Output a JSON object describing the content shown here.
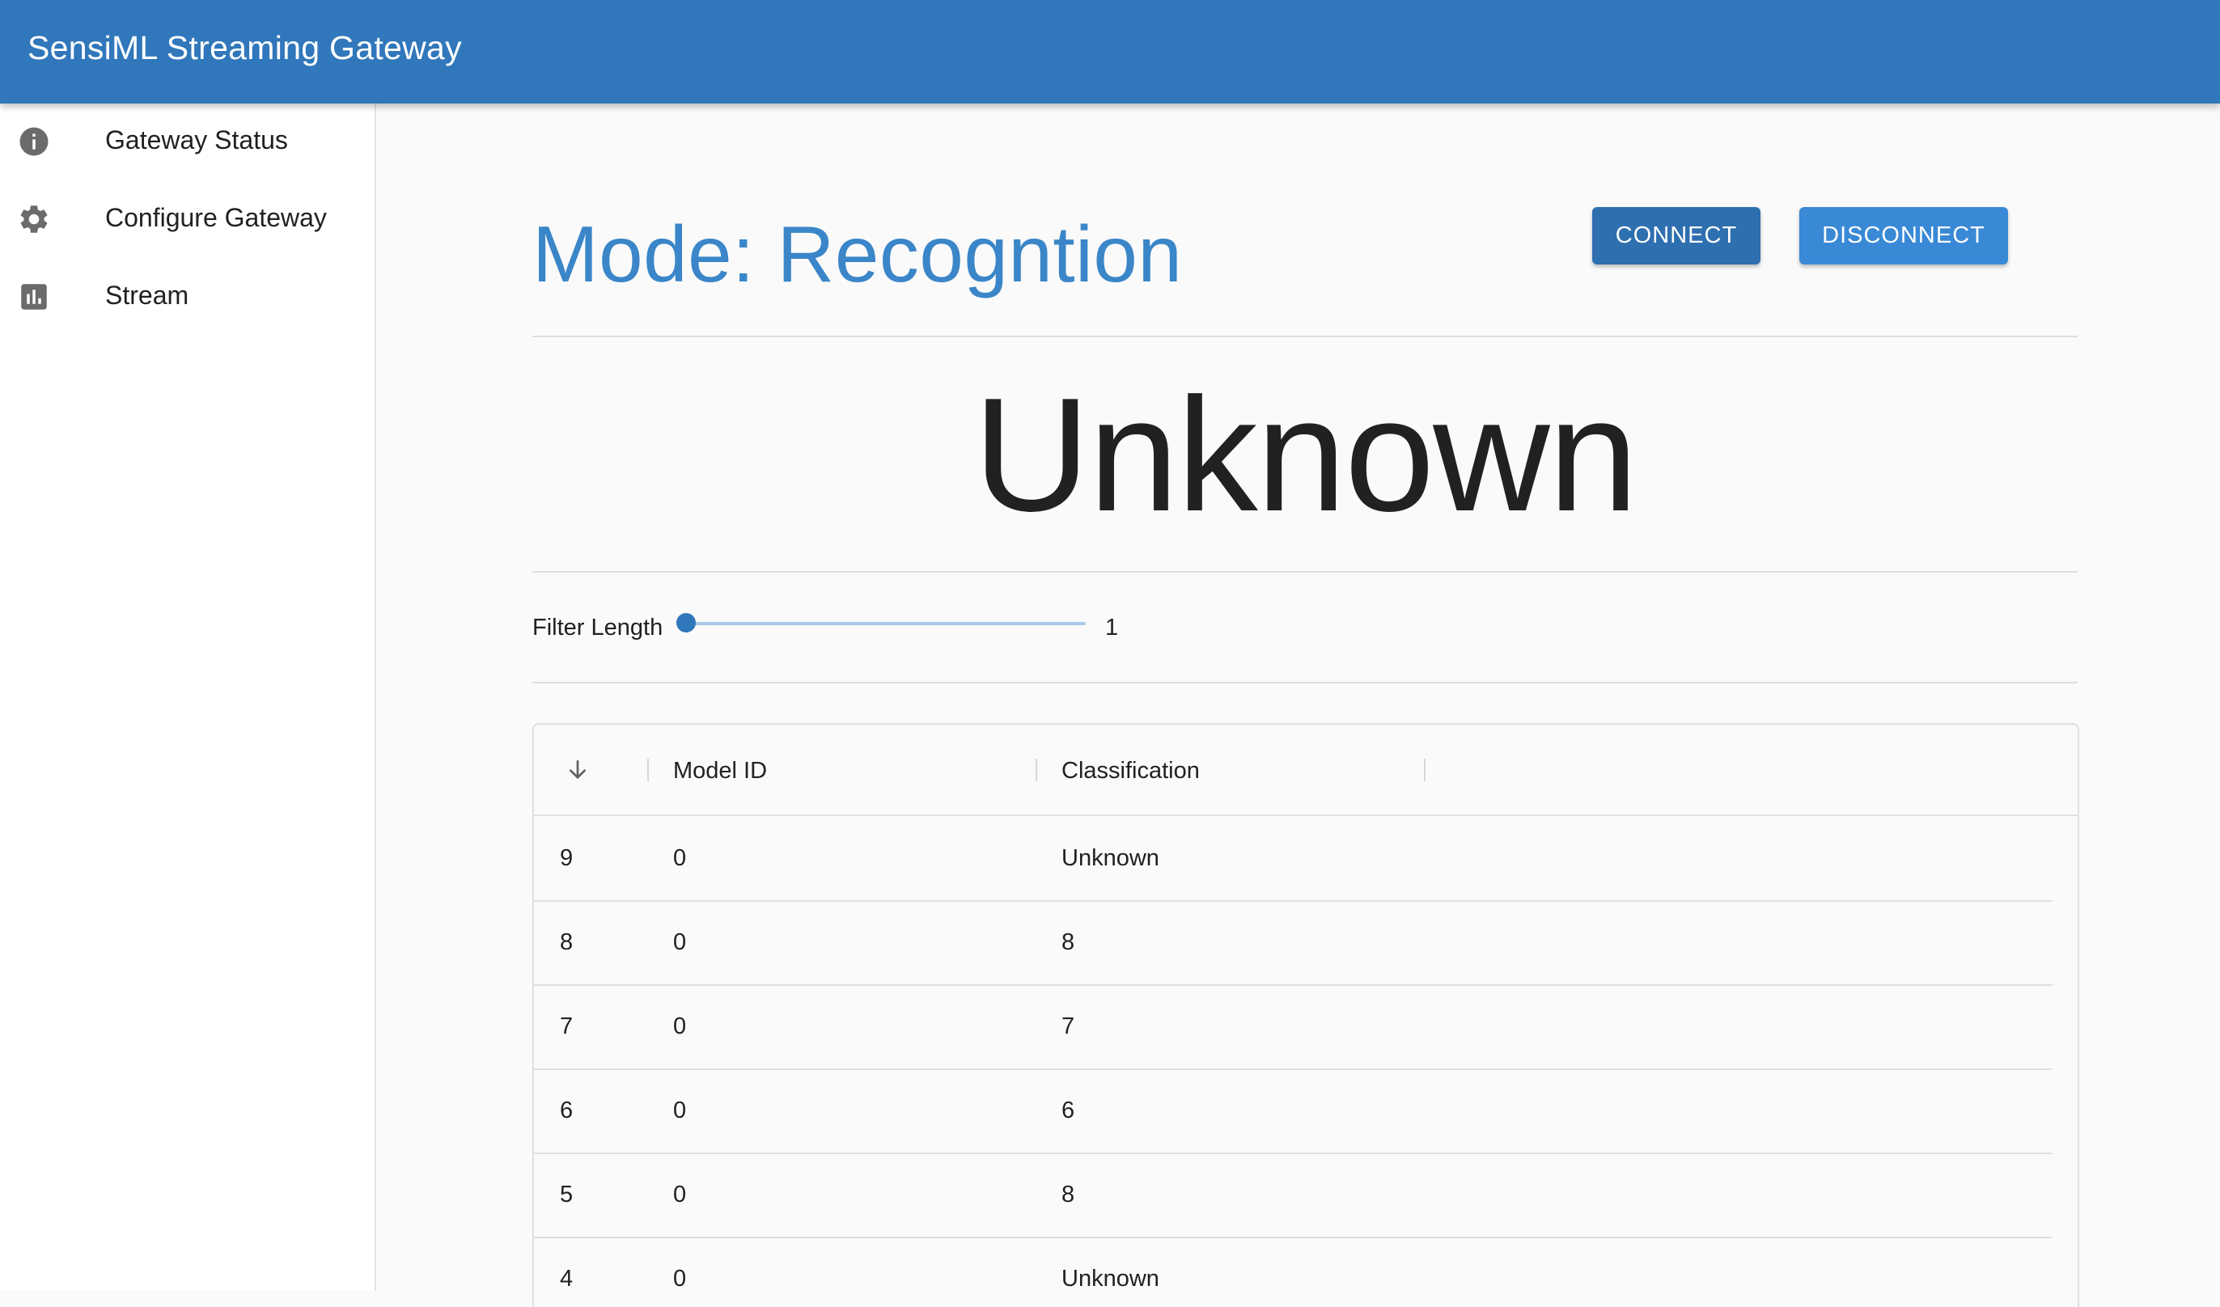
{
  "app": {
    "title": "SensiML Streaming Gateway"
  },
  "sidebar": {
    "items": [
      {
        "label": "Gateway Status",
        "icon": "info-icon"
      },
      {
        "label": "Configure Gateway",
        "icon": "gear-icon"
      },
      {
        "label": "Stream",
        "icon": "bar-chart-icon"
      }
    ]
  },
  "main": {
    "mode_title": "Mode: Recogntion",
    "connect_label": "CONNECT",
    "disconnect_label": "DISCONNECT",
    "result_text": "Unknown",
    "filter": {
      "label": "Filter Length",
      "value": "1",
      "fraction": 0.0
    },
    "table": {
      "sort_icon": "arrow-down-icon",
      "columns": [
        "Model ID",
        "Classification"
      ],
      "rows": [
        {
          "index": "9",
          "model_id": "0",
          "classification": "Unknown"
        },
        {
          "index": "8",
          "model_id": "0",
          "classification": "8"
        },
        {
          "index": "7",
          "model_id": "0",
          "classification": "7"
        },
        {
          "index": "6",
          "model_id": "0",
          "classification": "6"
        },
        {
          "index": "5",
          "model_id": "0",
          "classification": "8"
        },
        {
          "index": "4",
          "model_id": "0",
          "classification": "Unknown"
        }
      ]
    }
  },
  "colors": {
    "primary": "#3177bb",
    "title_accent": "#3a86c8",
    "connect_button": "#2e6fb0",
    "disconnect_button": "#3989d6"
  }
}
